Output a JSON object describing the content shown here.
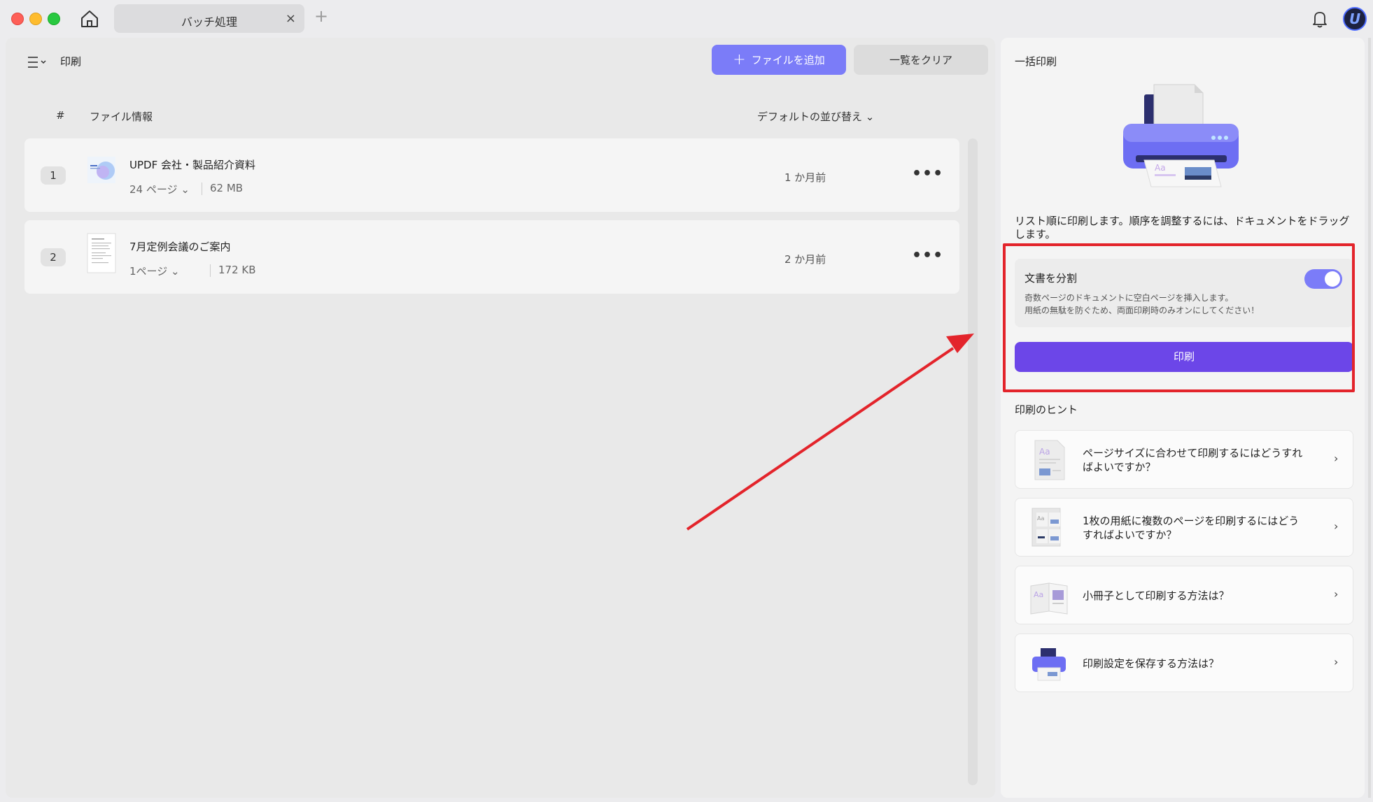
{
  "window": {
    "tab_title": "バッチ処理",
    "tab_close": "×",
    "tab_add": "+"
  },
  "header": {
    "title": "印刷",
    "add_file_plus": "+",
    "add_file_label": "ファイルを追加",
    "clear_label": "一覧をクリア"
  },
  "table": {
    "col_number": "#",
    "col_info": "ファイル情報",
    "sort_label": "デフォルトの並び替え ⌄",
    "rows": [
      {
        "num": "1",
        "name": "UPDF 会社・製品紹介資料",
        "pages": "24 ページ ⌄",
        "size": "62 MB",
        "date": "1 か月前",
        "more": "•••"
      },
      {
        "num": "2",
        "name": "7月定例会議のご案内",
        "pages": "1ページ ⌄",
        "size": "172 KB",
        "date": "2 か月前",
        "more": "•••"
      }
    ]
  },
  "sidebar": {
    "title": "一括印刷",
    "instruction": "リスト順に印刷します。順序を調整するには、ドキュメントをドラッグします。",
    "split": {
      "title": "文書を分割",
      "desc1": "奇数ページのドキュメントに空白ページを挿入します。",
      "desc2": "用紙の無駄を防ぐため、両面印刷時のみオンにしてください！",
      "enabled": true
    },
    "print_label": "印刷",
    "tips_title": "印刷のヒント",
    "tips": [
      {
        "text": "ページサイズに合わせて印刷するにはどうすればよいですか？",
        "icon": "page-fit-icon"
      },
      {
        "text": "1枚の用紙に複数のページを印刷するにはどうすればよいですか？",
        "icon": "multi-page-icon"
      },
      {
        "text": "小冊子として印刷する方法は？",
        "icon": "booklet-icon"
      },
      {
        "text": "印刷設定を保存する方法は？",
        "icon": "printer-icon"
      }
    ],
    "chevron": "›"
  },
  "colors": {
    "accent": "#7b7cf8",
    "print_button": "#6c46e8",
    "highlight": "#e3242b"
  }
}
